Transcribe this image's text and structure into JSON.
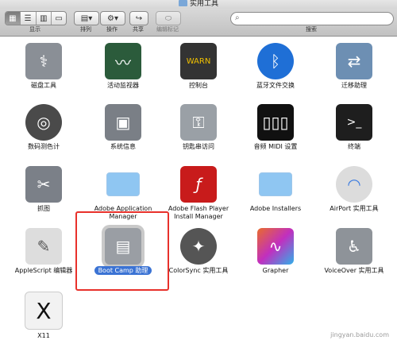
{
  "window": {
    "title": "实用工具"
  },
  "toolbar": {
    "view_label": "显示",
    "arrange_label": "排列",
    "action_label": "操作",
    "share_label": "共享",
    "edit_tags_label": "编辑标记",
    "search_label": "搜索"
  },
  "apps": [
    {
      "label": "磁盘工具",
      "icon": "disk-utility-icon",
      "color": "#8a8f96"
    },
    {
      "label": "活动监视器",
      "icon": "activity-monitor-icon",
      "color": "#2b5b3b"
    },
    {
      "label": "控制台",
      "icon": "console-icon",
      "color": "#333333"
    },
    {
      "label": "蓝牙文件交换",
      "icon": "bluetooth-icon",
      "color": "#1f6fd6"
    },
    {
      "label": "迁移助理",
      "icon": "migration-assistant-icon",
      "color": "#6d8fb3"
    },
    {
      "label": "数码测色计",
      "icon": "color-meter-icon",
      "color": "#4a4a4a"
    },
    {
      "label": "系统信息",
      "icon": "system-information-icon",
      "color": "#7a7f86"
    },
    {
      "label": "钥匙串访问",
      "icon": "keychain-icon",
      "color": "#9aa0a6"
    },
    {
      "label": "音频 MIDI 设置",
      "icon": "midi-keyboard-icon",
      "color": "#111111"
    },
    {
      "label": "终端",
      "icon": "terminal-icon",
      "color": "#1e1e1e"
    },
    {
      "label": "抓图",
      "icon": "grab-icon",
      "color": "#7b8088"
    },
    {
      "label": "Adobe Application Manager",
      "icon": "folder-icon",
      "color": "#7fbdf0"
    },
    {
      "label": "Adobe Flash Player Install Manager",
      "icon": "flash-icon",
      "color": "#c81b1b"
    },
    {
      "label": "Adobe Installers",
      "icon": "folder-icon",
      "color": "#7fbdf0"
    },
    {
      "label": "AirPort 实用工具",
      "icon": "airport-icon",
      "color": "#dcdcdc"
    },
    {
      "label": "AppleScript 编辑器",
      "icon": "applescript-icon",
      "color": "#dddddd"
    },
    {
      "label": "Boot Camp 助理",
      "icon": "boot-camp-icon",
      "color": "#9a9ea4"
    },
    {
      "label": "ColorSync 实用工具",
      "icon": "colorsync-icon",
      "color": "#555555"
    },
    {
      "label": "Grapher",
      "icon": "grapher-icon",
      "color": "#e96b2b"
    },
    {
      "label": "VoiceOver 实用工具",
      "icon": "voiceover-icon",
      "color": "#8e9399"
    },
    {
      "label": "X11",
      "icon": "x11-icon",
      "color": "#f2f2f2"
    }
  ],
  "watermark": "jingyan.baidu.com"
}
